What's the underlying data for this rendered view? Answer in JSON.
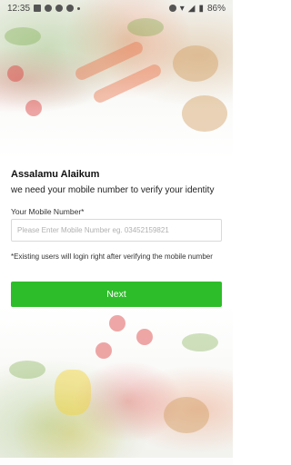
{
  "status_bar": {
    "time": "12:35",
    "battery": "86%",
    "icons": [
      "image-icon",
      "p-icon",
      "facebook-icon",
      "whatsapp-icon",
      "dot",
      "alarm-icon",
      "wifi-icon",
      "signal-icon",
      "battery-icon"
    ]
  },
  "login": {
    "greeting": "Assalamu Alaikum",
    "subtitle": "we need your mobile number to verify your identity",
    "field_label": "Your Mobile Number*",
    "phone_placeholder": "Please Enter Mobile Number eg. 03452159821",
    "phone_value": "",
    "note": "*Existing users will login right after verifying the mobile number",
    "next_label": "Next"
  },
  "colors": {
    "accent": "#2ebd2a",
    "button_text": "#ffffff"
  }
}
